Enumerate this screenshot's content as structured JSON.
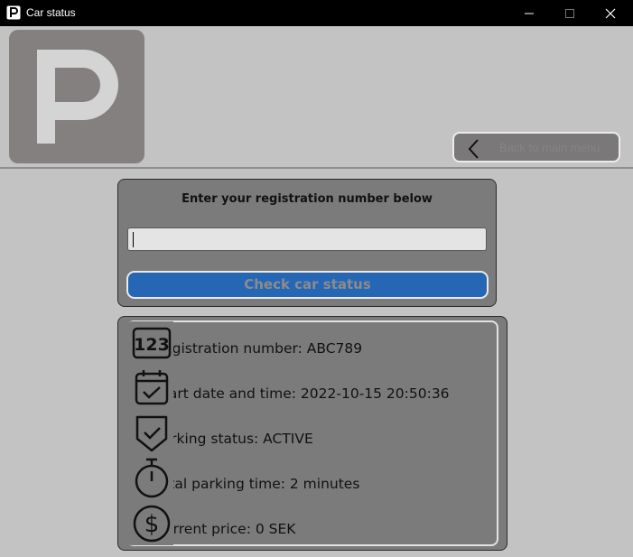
{
  "window": {
    "title": "Car status",
    "app_icon": "parking-p-icon",
    "controls": [
      "minimize-icon",
      "maximize-icon",
      "close-icon"
    ]
  },
  "header": {
    "logo_letter": "P",
    "back_button_label": "Back to main menu"
  },
  "input_panel": {
    "prompt": "Enter your registration number below",
    "input_value": "",
    "check_button_label": "Check car status"
  },
  "status": {
    "rows": [
      {
        "icon": "registration-123-icon",
        "text": "Registration number: ABC789"
      },
      {
        "icon": "calendar-check-icon",
        "text": "Start date and time: 2022-10-15 20:50:36"
      },
      {
        "icon": "shield-check-icon",
        "text": "Parking status: ACTIVE"
      },
      {
        "icon": "stopwatch-icon",
        "text": "Total parking time: 2 minutes"
      },
      {
        "icon": "dollar-circle-icon",
        "text": "Current price: 0 SEK"
      }
    ]
  },
  "colors": {
    "titlebar": "#000000",
    "background": "#c3c3c3",
    "panel": "#7b7b7b",
    "logo_tile": "#858080",
    "check_button": "#2566b5"
  }
}
